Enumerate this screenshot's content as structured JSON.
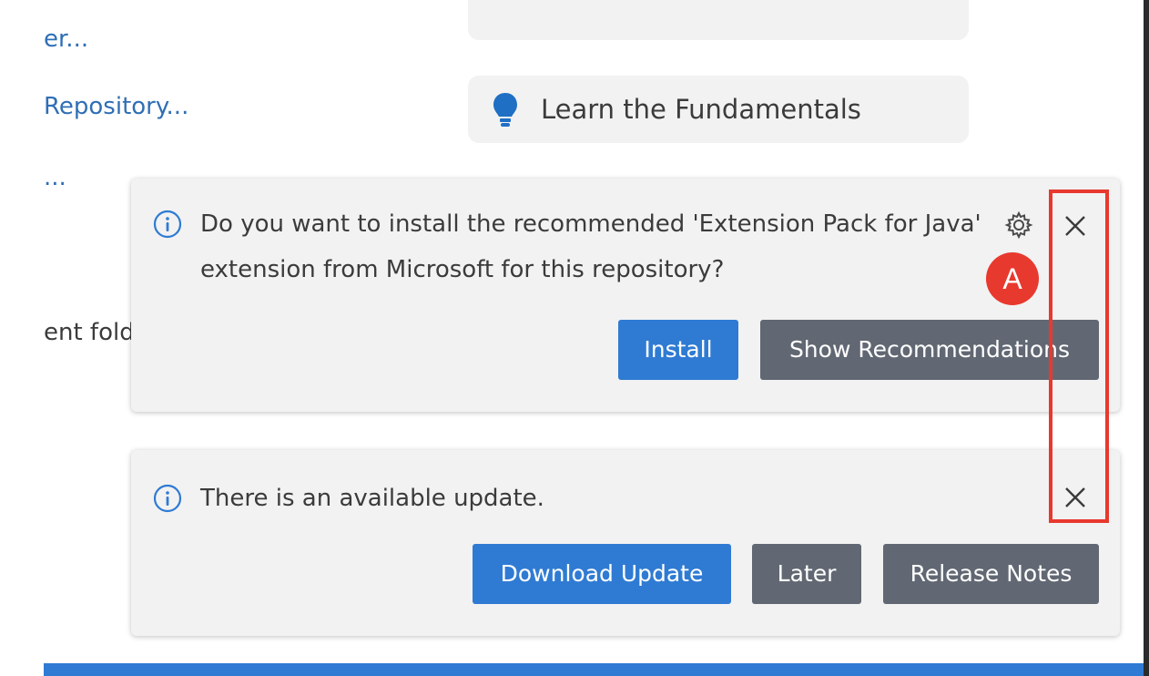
{
  "left_panel": {
    "links": [
      "er...",
      "Repository...",
      "..."
    ],
    "text": "ent folder"
  },
  "walkthroughs": {
    "learn_label": "Learn the Fundamentals",
    "icon": "lightbulb-icon"
  },
  "notifications": [
    {
      "message": "Do you want to install the recommended 'Extension Pack for Java' extension from Microsoft for this repository?",
      "buttons": [
        "Install",
        "Show Recommendations"
      ],
      "has_gear": true
    },
    {
      "message": "There is an available update.",
      "buttons": [
        "Download Update",
        "Later",
        "Release Notes"
      ],
      "has_gear": false
    }
  ],
  "annotation": {
    "label": "A",
    "color": "#e8392e"
  },
  "colors": {
    "primary_button": "#2f7bd3",
    "secondary_button": "#616873",
    "link": "#2f6fb5",
    "status_bar": "#2f7bd3"
  }
}
